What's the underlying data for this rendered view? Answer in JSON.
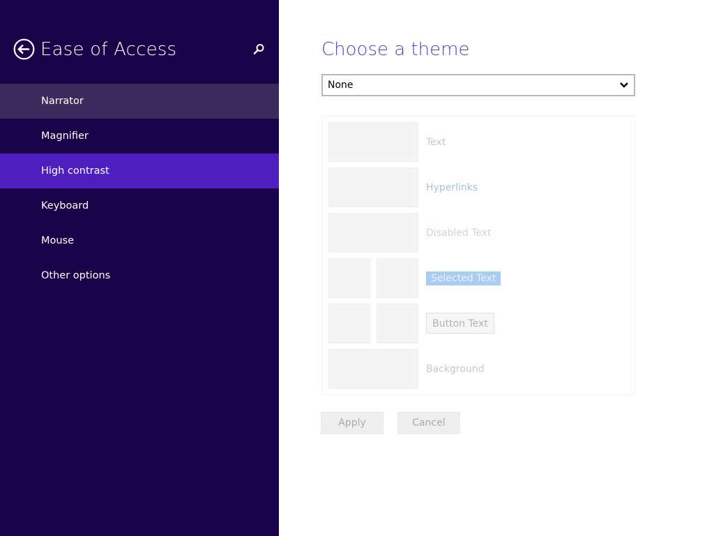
{
  "nav": {
    "title": "Ease of Access",
    "back_icon": "back-arrow-icon",
    "search_icon": "search-icon",
    "items": [
      {
        "label": "Narrator"
      },
      {
        "label": "Magnifier"
      },
      {
        "label": "High contrast"
      },
      {
        "label": "Keyboard"
      },
      {
        "label": "Mouse"
      },
      {
        "label": "Other options"
      }
    ],
    "selected_index": 2,
    "hover_index": 0
  },
  "content": {
    "title": "Choose a theme",
    "theme_select": {
      "value": "None"
    },
    "preview": {
      "text_label": "Text",
      "hyperlinks_label": "Hyperlinks",
      "disabled_label": "Disabled Text",
      "selected_label": "Selected Text",
      "button_label": "Button Text",
      "background_label": "Background"
    },
    "apply_label": "Apply",
    "cancel_label": "Cancel"
  },
  "colors": {
    "nav_background": "#1a0349",
    "nav_selected": "#4e1ebf",
    "nav_hover": "#3b2c5d",
    "title_accent": "#5b3fb8"
  }
}
